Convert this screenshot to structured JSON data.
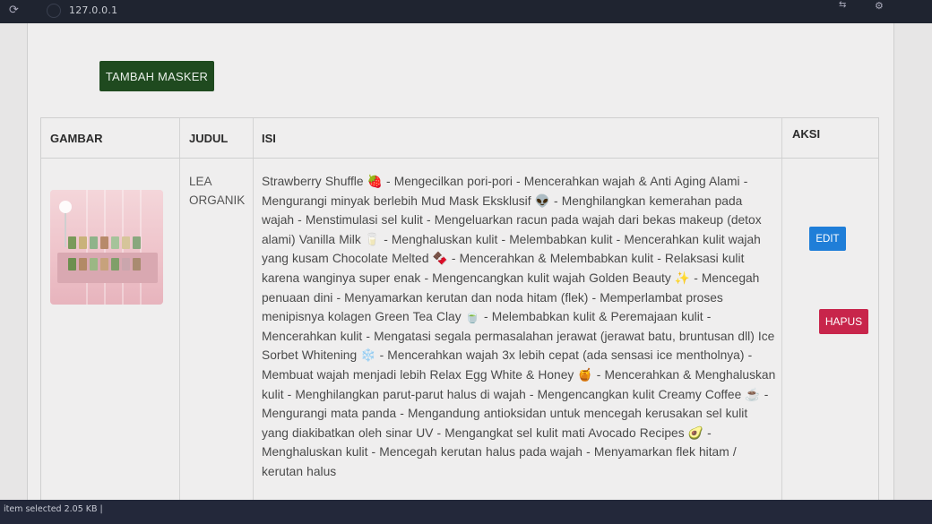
{
  "browser": {
    "url": "127.0.0.1"
  },
  "toolbar": {
    "add_label": "TAMBAH MASKER"
  },
  "table": {
    "headers": [
      "GAMBAR",
      "JUDUL",
      "ISI",
      "AKSI"
    ],
    "rows": [
      {
        "judul": "LEA ORGANIK",
        "isi": "Strawberry Shuffle 🍓 - Mengecilkan pori-pori - Mencerahkan wajah & Anti Aging Alami - Mengurangi minyak berlebih Mud Mask Eksklusif 👽 - Menghilangkan kemerahan pada wajah - Menstimulasi sel kulit - Mengeluarkan racun pada wajah dari bekas makeup (detox alami) Vanilla Milk 🥛 - Menghaluskan kulit - Melembabkan kulit - Mencerahkan kulit wajah yang kusam Chocolate Melted 🍫 - Mencerahkan & Melembabkan kulit - Relaksasi kulit karena wanginya super enak - Mengencangkan kulit wajah Golden Beauty ✨ - Mencegah penuaan dini - Menyamarkan kerutan dan noda hitam (flek) - Memperlambat proses menipisnya kolagen Green Tea Clay 🍵 - Melembabkan kulit & Peremajaan kulit - Mencerahkan kulit - Mengatasi segala permasalahan jerawat (jerawat batu, bruntusan dll) Ice Sorbet Whitening ❄️ - Mencerahkan wajah 3x lebih cepat (ada sensasi ice mentholnya) - Membuat wajah menjadi lebih Relax Egg White & Honey 🍯 - Mencerahkan & Menghaluskan kulit - Menghilangkan parut-parut halus di wajah - Mengencangkan kulit Creamy Coffee ☕ - Mengurangi mata panda - Mengandung antioksidan untuk mencegah kerusakan sel kulit yang diakibatkan oleh sinar UV - Mengangkat sel kulit mati Avocado Recipes 🥑 - Menghaluskan kulit - Mencegah kerutan halus pada wajah - Menyamarkan flek hitam / kerutan halus",
        "edit_label": "EDIT",
        "delete_label": "HAPUS"
      }
    ]
  },
  "statusbar": {
    "text": "item selected  2.05 KB  |"
  },
  "colors": {
    "add_button": "#1f4a1f",
    "edit_button": "#1f7ed8",
    "delete_button": "#c8254b"
  }
}
